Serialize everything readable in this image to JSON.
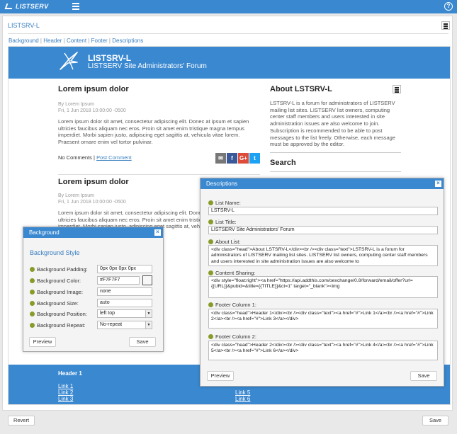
{
  "app": {
    "name": "LISTSERV"
  },
  "colors": {
    "accent": "#3a88d0",
    "link": "#3a7fc0",
    "swatch": "#F7F7F7"
  },
  "page": {
    "crumb": "LISTSRV-L",
    "links": [
      "Background",
      "Header",
      "Content",
      "Footer",
      "Descriptions"
    ],
    "revert_label": "Revert",
    "save_label": "Save"
  },
  "preview": {
    "banner_title": "LISTSRV-L",
    "banner_subtitle": "LISTSERV Site Administrators' Forum",
    "posts": [
      {
        "title": "Lorem ipsum dolor",
        "author": "By Lorem Ipsum",
        "date": "Fri, 1 Jun 2018 10:00:00 -0500",
        "body": "Lorem ipsum dolor sit amet, consectetur adipiscing elit. Donec at ipsum et sapien ultricies faucibus aliquam nec eros. Proin sit amet enim tristique magna tempus imperdiet. Morbi sapien justo, adipiscing eget sagittis at, vehicula vitae lorem. Praesent ornare enim vel tortor pulvinar.",
        "comments": "No Comments",
        "post_comment": "Post Comment"
      },
      {
        "title": "Lorem ipsum dolor",
        "author": "By Lorem Ipsum",
        "date": "Fri, 1 Jun 2018 10:00:00 -0500",
        "body": "Lorem ipsum dolor sit amet, consectetur adipiscing elit. Donec at ipsum et sapien ultricies faucibus aliquam nec eros. Proin sit amet enim tristique magna tempus imperdiet. Morbi sapien justo, adipiscing eget sagittis at, vehicula vitae lorem. Praesent ornare enim vel tortor pulvinar."
      }
    ],
    "about_title": "About LSTSRV-L",
    "about_text": "LSTSRV-L is a forum for administrators of LISTSERV mailing list sites. LISTSERV list owners, computing center staff members and users interested in site administration issues are also welcome to join. Subscription is recommended to be able to post messages to the list freely. Otherwise, each message must be approved by the editor.",
    "search_title": "Search",
    "share_icons": [
      "email-icon",
      "facebook-icon",
      "google-plus-icon",
      "twitter-icon"
    ],
    "footer": [
      {
        "header": "Header 1",
        "links": [
          "Link 1",
          "Link 2",
          "Link 3"
        ]
      },
      {
        "header": "",
        "links": [
          "Link 5",
          "Link 6"
        ]
      }
    ]
  },
  "background_dialog": {
    "title": "Background",
    "section": "Background Style",
    "fields": [
      {
        "label": "Background Padding:",
        "value": "0px 0px 0px 0px"
      },
      {
        "label": "Background Color:",
        "value": "#F7F7F7"
      },
      {
        "label": "Background Image:",
        "value": "none"
      },
      {
        "label": "Background Size:",
        "value": "auto"
      },
      {
        "label": "Background Position:",
        "value": "left top"
      },
      {
        "label": "Background Repeat:",
        "value": "No-repeat"
      }
    ],
    "preview_label": "Preview",
    "save_label": "Save"
  },
  "descriptions_dialog": {
    "title": "Descriptions",
    "list_name_label": "List Name:",
    "list_name": "LSTSRV-L",
    "list_title_label": "List Title:",
    "list_title": "LISTSERV Site Administrators' Forum",
    "about_label": "About List:",
    "about_value": "<div class=\"head\">About LSTSRV-L</div><br /><div class=\"text\">LSTSRV-L is a forum for administrators of LISTSERV mailing list sites.  LISTSERV list owners, computing center staff members and users interested in site administration issues are also welcome to",
    "sharing_label": "Content Sharing:",
    "sharing_value": "<div style=\"float:right\"><a href=\"https://api.addthis.com/oexchange/0.8/forward/email/offer?url={{URL}}&pubid=&title={{TITLE}}&ct=1\" target=\"_blank\"><img",
    "footer1_label": "Footer Column 1:",
    "footer1_value": "<div class=\"head\">Header 1</div><br /><div class=\"text\"><a href=\"#\">Link 1</a><br /><a href=\"#\">Link 2</a><br /><a href=\"#\">Link 3</a></div>",
    "footer2_label": "Footer Column 2:",
    "footer2_value": "<div class=\"head\">Header 2</div><br /><div class=\"text\"><a href=\"#\">Link 4</a><br /><a href=\"#\">Link 5</a><br /><a href=\"#\">Link 6</a></div>",
    "preview_label": "Preview",
    "save_label": "Save"
  }
}
